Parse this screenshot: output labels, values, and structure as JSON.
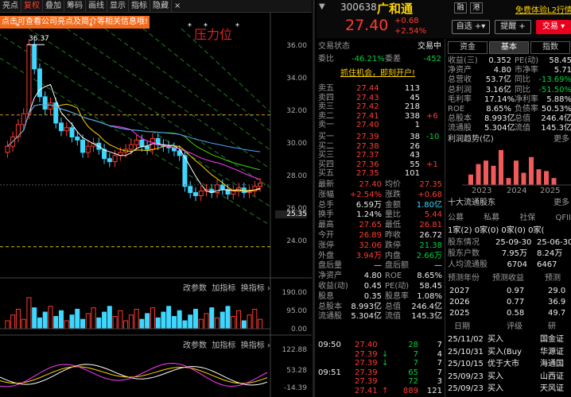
{
  "toolbar": {
    "items": [
      "亮点",
      "复权",
      "叠加",
      "筹码",
      "画线",
      "显示",
      "指标",
      "隐藏"
    ],
    "close": "×"
  },
  "tooltip": "点击可查看公司亮点及简介等相关信息哦!",
  "chart": {
    "high_label": "36.37",
    "stamp": "压力位",
    "yticks": [
      "36.00",
      "34.00",
      "32.00",
      "30.00",
      "28.00",
      "26.00",
      "24.00"
    ],
    "current_price_tag": "25.35",
    "vol_toolbar": [
      "改参数",
      "加指标",
      "换指标"
    ],
    "vol_ticks": [
      "190.00",
      "95.00",
      "0.00"
    ],
    "ind_toolbar": [
      "改参数",
      "加指标",
      "换指标"
    ],
    "ind_ticks": [
      "122.88",
      "53.28",
      "-14.39"
    ],
    "chart_data": {
      "type": "candlestick",
      "ylim": [
        22,
        37
      ],
      "closes": [
        29.8,
        30.4,
        31.2,
        31.9,
        36.37,
        34.8,
        33.0,
        32.2,
        32.6,
        31.3,
        30.8,
        31.0,
        30.4,
        30.2,
        29.4,
        29.8,
        30.0,
        29.6,
        29.0,
        28.8,
        29.2,
        29.4,
        29.6,
        29.9,
        30.2,
        29.8,
        29.6,
        30.3,
        29.9,
        29.8,
        29.7,
        29.5,
        29.2,
        27.2,
        26.8,
        26.6,
        26.9,
        27.0,
        26.8,
        27.3,
        27.0,
        26.7,
        26.9,
        27.1,
        26.8,
        26.9,
        27.2,
        27.4
      ]
    }
  },
  "quote": {
    "code": "300638",
    "name": "广和通",
    "rong": "融",
    "gang": "港",
    "price": "27.40",
    "change": "+0.68",
    "pct": "+2.54%",
    "promo": "免费体验L2行情",
    "btn_watch": "自选",
    "btn_remind": "提醒",
    "btn_trade": "交易"
  },
  "trade": {
    "status_label": "交易状态",
    "status_value": "交易中",
    "weibi_label": "委比",
    "weibi": "-46.21%",
    "weicha_label": "委差",
    "weicha": "-452",
    "banner": "抓住机会，即刻开户!",
    "asks": [
      [
        "卖五",
        "27.44",
        "113",
        ""
      ],
      [
        "卖四",
        "27.43",
        "45",
        ""
      ],
      [
        "卖三",
        "27.42",
        "218",
        ""
      ],
      [
        "卖二",
        "27.41",
        "338",
        "+6"
      ],
      [
        "卖一",
        "27.40",
        "1",
        ""
      ]
    ],
    "bids": [
      [
        "买一",
        "27.39",
        "38",
        "-10"
      ],
      [
        "买二",
        "27.38",
        "26",
        ""
      ],
      [
        "买三",
        "27.37",
        "43",
        ""
      ],
      [
        "买四",
        "27.36",
        "55",
        "+1"
      ],
      [
        "买五",
        "27.35",
        "101",
        ""
      ]
    ],
    "stats": [
      [
        "最新",
        "27.40",
        "均价",
        "27.35"
      ],
      [
        "涨幅",
        "+2.54%",
        "涨跌",
        "+0.68"
      ],
      [
        "总手",
        "6.59万",
        "金额",
        "1.80亿"
      ],
      [
        "换手",
        "1.24%",
        "量比",
        "5.44"
      ],
      [
        "最高",
        "27.65",
        "最低",
        "26.81"
      ],
      [
        "今开",
        "26.89",
        "昨收",
        "26.72"
      ],
      [
        "涨停",
        "32.06",
        "跌停",
        "21.38"
      ],
      [
        "外盘",
        "3.94万",
        "内盘",
        "2.66万"
      ],
      [
        "盘后量",
        "—",
        "盘后额",
        "—"
      ],
      [
        "净资产",
        "4.80",
        "ROE",
        "8.65%"
      ],
      [
        "收益(动)",
        "0.45",
        "PE(动)",
        "58.45"
      ],
      [
        "股息",
        "0.35",
        "股息率",
        "1.08%"
      ],
      [
        "总股本",
        "8.993亿",
        "总值",
        "246.4亿"
      ],
      [
        "流通股",
        "5.304亿",
        "流值",
        "145.3亿"
      ]
    ],
    "ticks": [
      [
        "09:50",
        "27.40",
        "",
        "28",
        "7"
      ],
      [
        "",
        "27.39",
        "↓",
        "7",
        "4"
      ],
      [
        "",
        "27.39",
        "↓",
        "7",
        "7"
      ],
      [
        "09:51",
        "27.39",
        "",
        "65",
        "7"
      ],
      [
        "",
        "27.39",
        "",
        "72",
        "3"
      ],
      [
        "",
        "27.41",
        "↑",
        "889",
        "121"
      ]
    ]
  },
  "fin": {
    "tabs": [
      "资金",
      "基本",
      "指数"
    ],
    "rows": [
      [
        "收益(三)",
        "0.352",
        "PE(动)",
        "58.45"
      ],
      [
        "净资产",
        "4.80",
        "市净率",
        "5.71"
      ],
      [
        "总营收",
        "53.7亿",
        "同比",
        "-13.69%"
      ],
      [
        "总利润",
        "3.16亿",
        "同比",
        "-51.50%"
      ],
      [
        "毛利率",
        "17.14%",
        "净利率",
        "5.88%"
      ],
      [
        "ROE",
        "8.65%",
        "负债率",
        "50.53%"
      ],
      [
        "总股本",
        "8.993亿",
        "总值",
        "246.4亿"
      ],
      [
        "流通股",
        "5.304亿",
        "流值",
        "145.3亿"
      ]
    ],
    "profit_title": "利润趋势(亿)",
    "more": "更多",
    "years": [
      "2023",
      "2024",
      "2025"
    ],
    "bars": [
      0.3,
      0.6,
      0.7,
      0.55,
      1.0,
      0.2,
      0.7,
      0.35,
      0.8,
      0.45,
      0.4,
      0.2
    ],
    "holders_title": "十大流通股东",
    "holders_head": [
      "公募",
      "私募",
      "社保",
      "QFII"
    ],
    "holders_val": "1家(2)  0家(0)  0家(0)  0家(",
    "info": [
      [
        "股东情况",
        "25-09-30",
        "25-06-30"
      ],
      [
        "股东户数",
        "7.95万",
        "8.24万"
      ],
      [
        "人均流通股",
        "6704",
        "6467"
      ]
    ],
    "fc_head": [
      "预测年份",
      "预测收益",
      "预测"
    ],
    "forecast": [
      [
        "2027",
        "0.97",
        "29.0"
      ],
      [
        "2026",
        "0.77",
        "36.9"
      ],
      [
        "2025",
        "0.58",
        "49.7"
      ]
    ],
    "rating_head": [
      "日期",
      "评级",
      "研"
    ],
    "ratings": [
      [
        "25/11/02",
        "买入",
        "国金证"
      ],
      [
        "25/10/31",
        "买入(Buy",
        "华源证"
      ],
      [
        "25/10/15",
        "优于大市",
        "海通国"
      ],
      [
        "25/09/23",
        "买入",
        "山西证"
      ],
      [
        "25/09/23",
        "买入",
        "天风证"
      ]
    ]
  }
}
